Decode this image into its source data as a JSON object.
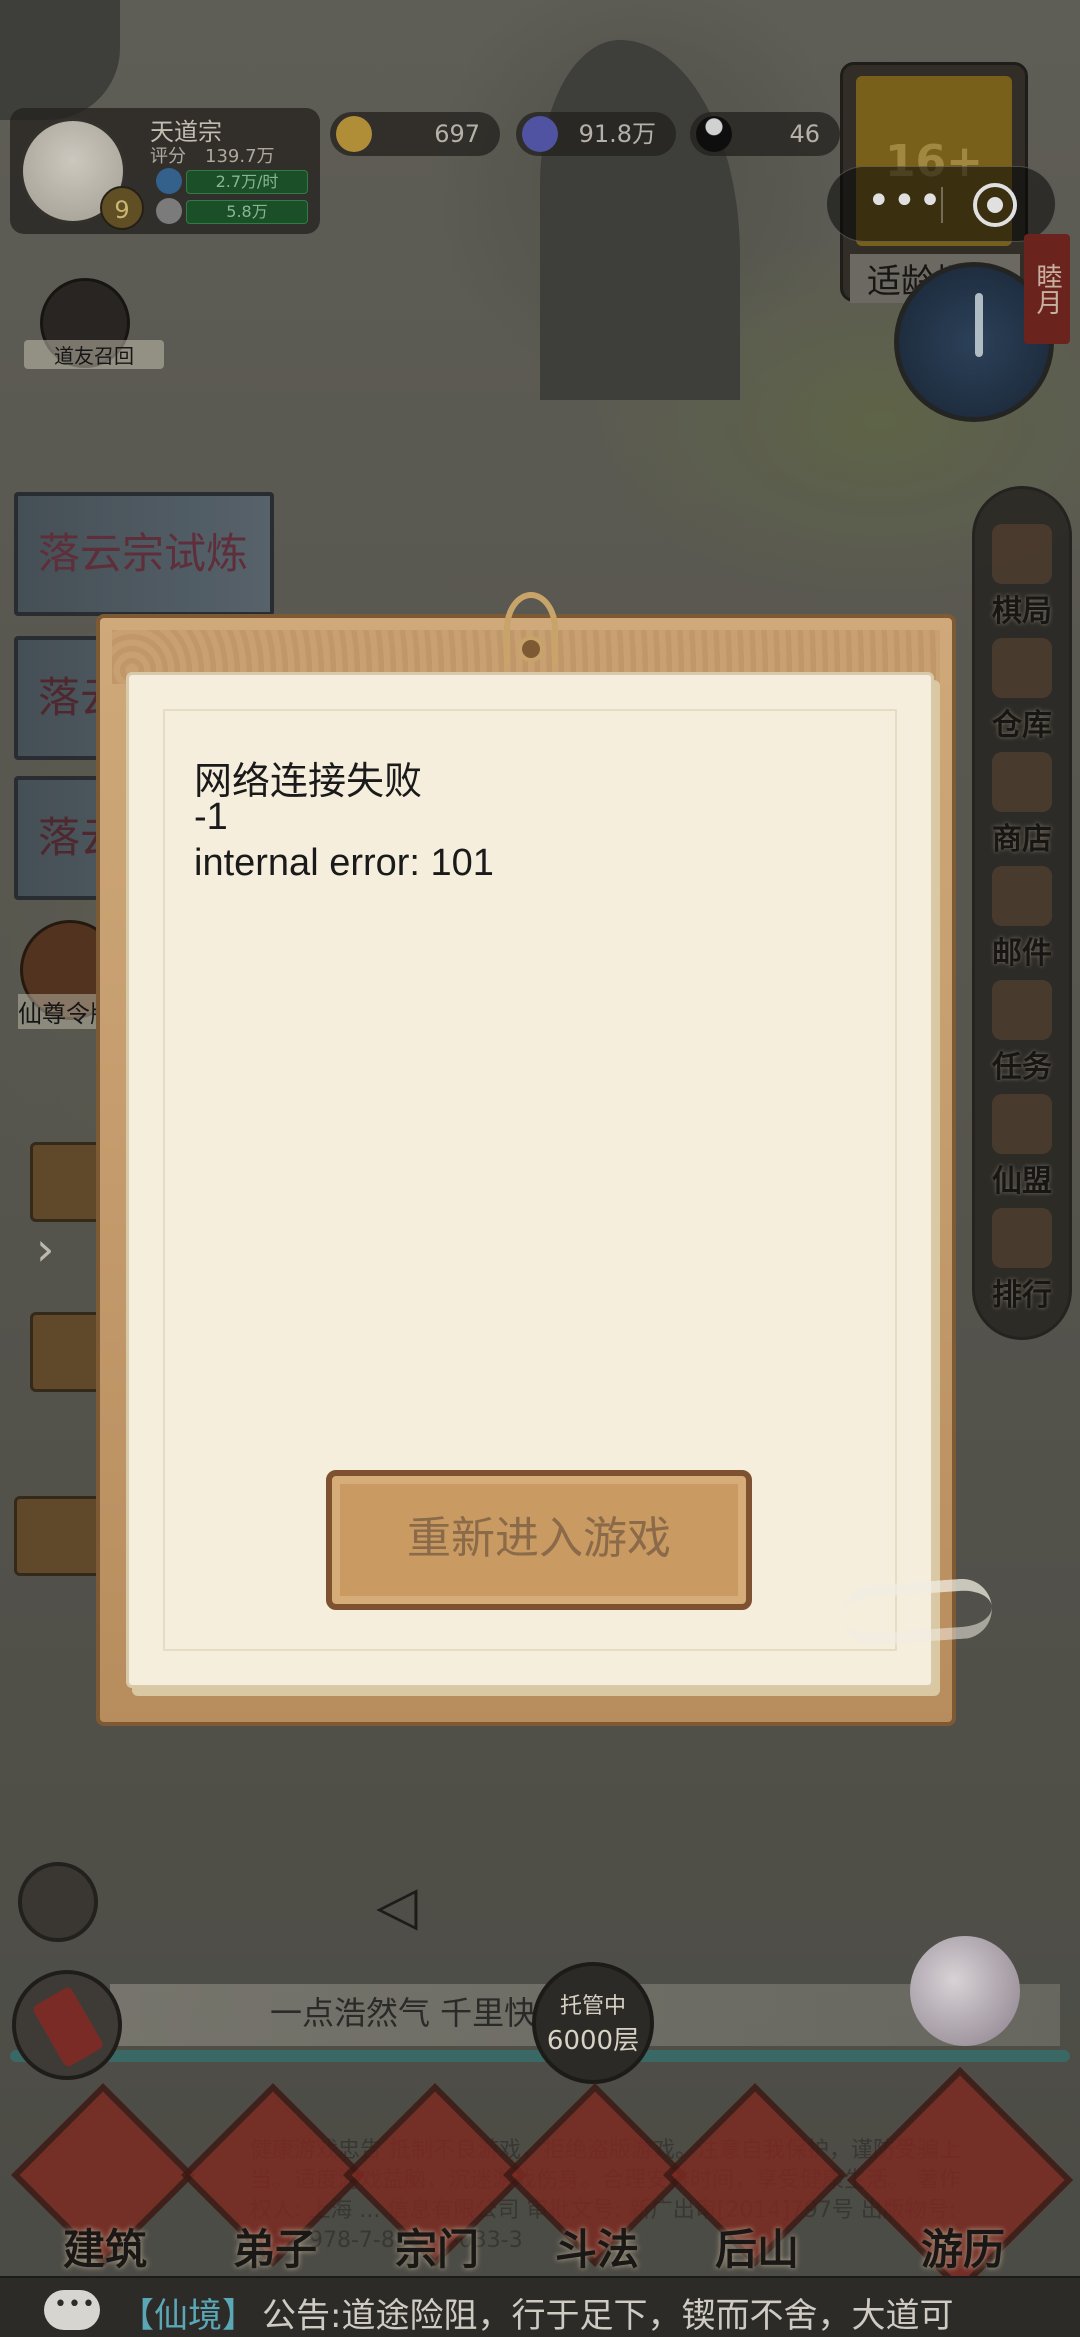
{
  "player": {
    "sect_name": "天道宗",
    "score_label": "评分",
    "score_value": "139.7万",
    "level": "9",
    "rate_1": "2.7万/时",
    "rate_2": "5.8万"
  },
  "resources": [
    {
      "icon": "spirit-stone-icon",
      "value": "697"
    },
    {
      "icon": "crystal-icon",
      "value": "91.8万"
    },
    {
      "icon": "taiji-icon",
      "value": "46"
    }
  ],
  "age_rating": {
    "label": "16+",
    "caption": "适龄提示"
  },
  "moon_tag": "睦月",
  "recall_label": "道友召回",
  "banners": [
    "落云宗试炼",
    "落云",
    "落云"
  ],
  "xianzun_label": "仙尊令牌",
  "right_menu": [
    "棋局",
    "仓库",
    "商店",
    "邮件",
    "任务",
    "仙盟",
    "排行"
  ],
  "dialog": {
    "line1": "网络连接失败",
    "line2": "-1",
    "line3": "internal error: 101",
    "retry_label": "重新进入游戏"
  },
  "ticker": "一点浩然气  千里快哉风",
  "auto_bubble": {
    "line1": "托管中",
    "line2": "6000层"
  },
  "nav": [
    "建筑",
    "弟子",
    "宗门",
    "斗法",
    "后山",
    "游历"
  ],
  "health_notice": "健康游戏忠告 抵制不良游戏，拒绝盗版游戏。注意自我保护，谨防受骗上当。适度游戏益脑，沉迷游戏伤身。合理安排时间，享受健康生活。 著作权人: 上海 ... 信息有限公司 审批文号: 新广出审[2014]797号 出版物号: ISBN 978-7-89988-033-3",
  "bottom_notice": {
    "tag": "【仙境】",
    "text": "公告:道途险阻，行于足下，锲而不舍，大道可"
  },
  "colors": {
    "accent_dialog": "#f5eedd",
    "button": "#c99a62",
    "notice_tag": "#5aa7b8"
  }
}
